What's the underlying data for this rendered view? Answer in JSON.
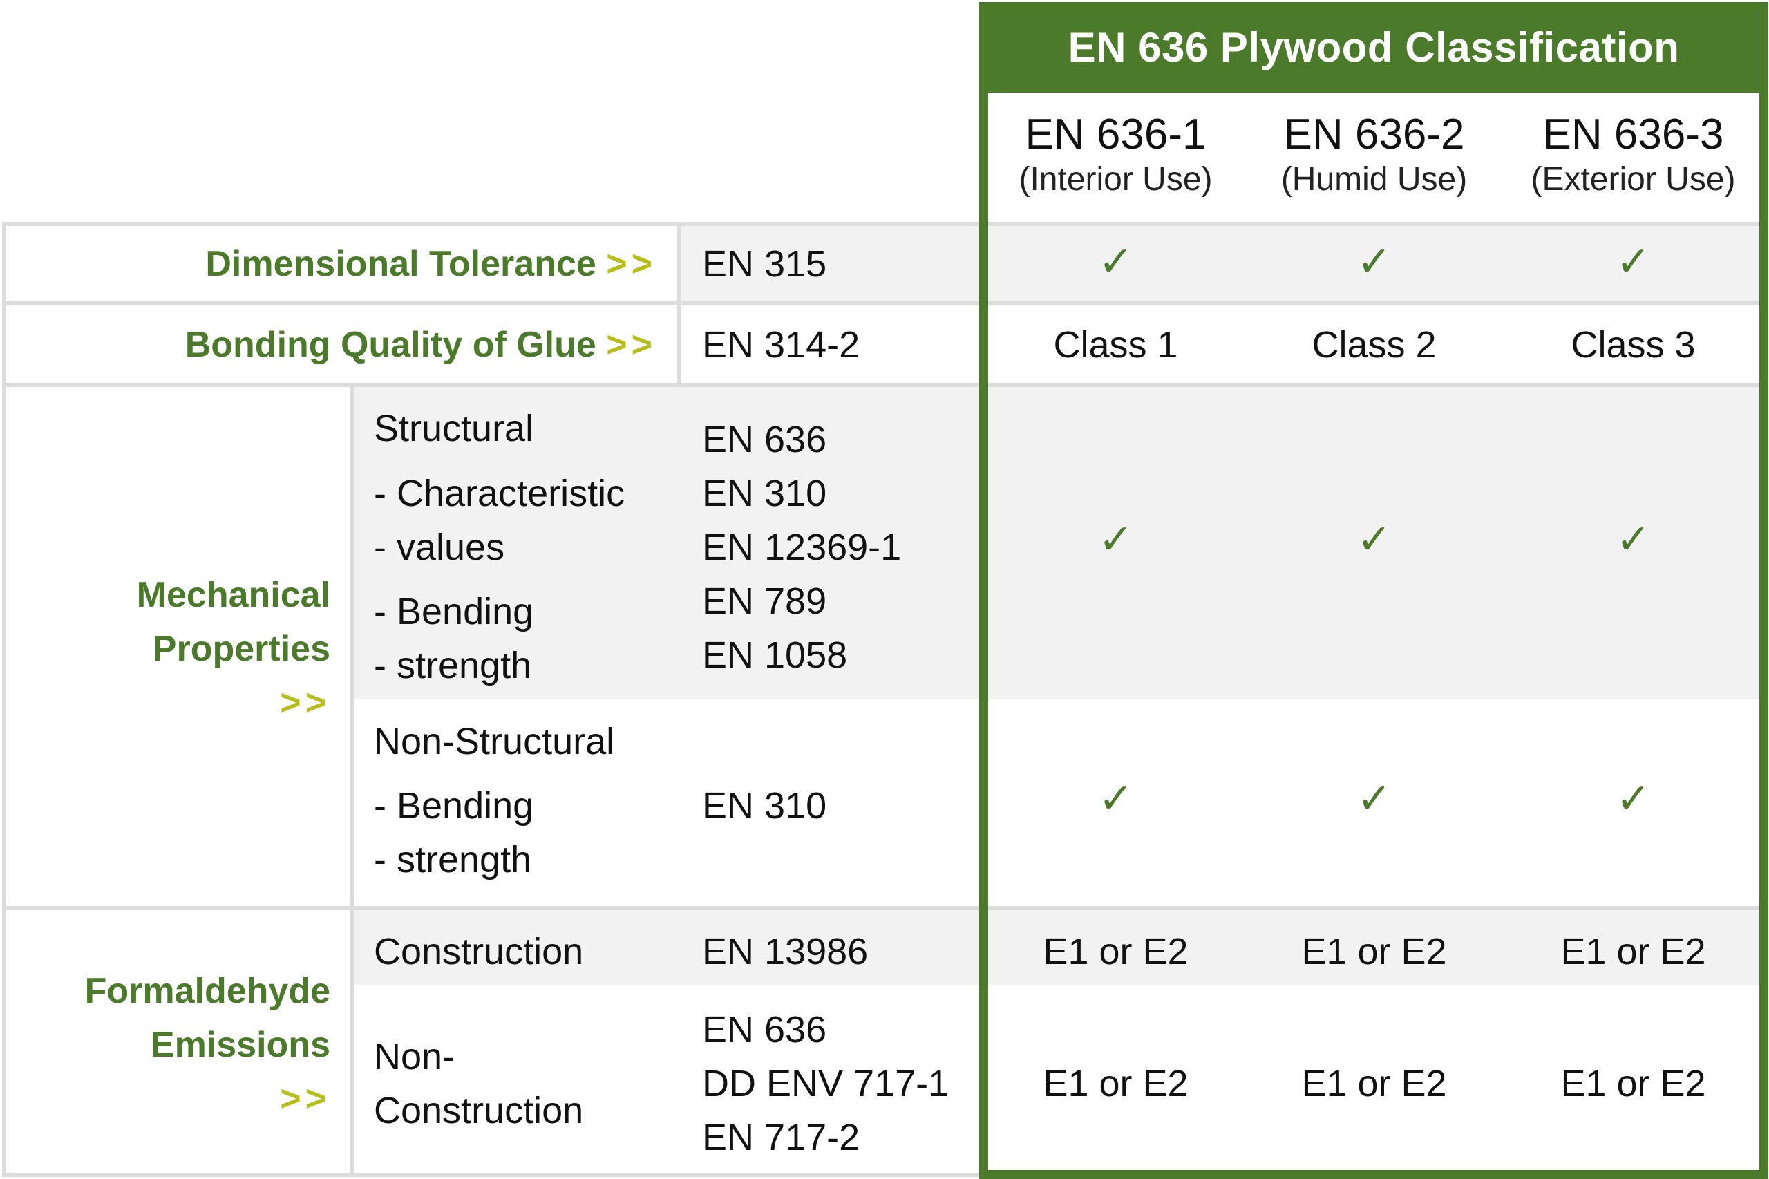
{
  "header": {
    "title": "EN 636 Plywood Classification",
    "columns": [
      {
        "code": "EN 636-1",
        "use": "(Interior Use)"
      },
      {
        "code": "EN 636-2",
        "use": "(Humid Use)"
      },
      {
        "code": "EN 636-3",
        "use": "(Exterior Use)"
      }
    ]
  },
  "chevron": ">>",
  "check_icon": "✓",
  "colors": {
    "brand_green": "#4a7a2a",
    "chevron_yellow_green": "#b5be1a",
    "row_gray": "#f2f2f2",
    "rule_gray": "#dcdcdc"
  },
  "rows": {
    "dimensional": {
      "label": "Dimensional Tolerance",
      "standard": "EN 315",
      "values": [
        "✓",
        "✓",
        "✓"
      ]
    },
    "bonding": {
      "label": "Bonding Quality of Glue",
      "standard": "EN 314-2",
      "values": [
        "Class 1",
        "Class 2",
        "Class 3"
      ]
    },
    "mechanical": {
      "label_line1": "Mechanical",
      "label_line2": "Properties",
      "structural": {
        "title": "Structural",
        "lines": [
          "- Characteristic",
          "- values",
          "- Bending",
          "- strength"
        ],
        "standards": [
          "EN 636",
          "EN 310",
          "EN 12369-1",
          "EN 789",
          "EN 1058"
        ],
        "values": [
          "✓",
          "✓",
          "✓"
        ]
      },
      "non_structural": {
        "title": "Non-Structural",
        "lines": [
          "- Bending",
          "- strength"
        ],
        "standards": [
          "EN 310"
        ],
        "values": [
          "✓",
          "✓",
          "✓"
        ]
      }
    },
    "formaldehyde": {
      "label_line1": "Formaldehyde",
      "label_line2": "Emissions",
      "construction": {
        "title": "Construction",
        "standards": [
          "EN 13986"
        ],
        "values": [
          "E1 or E2",
          "E1 or E2",
          "E1 or E2"
        ]
      },
      "non_construction": {
        "title_line1": "Non-",
        "title_line2": "Construction",
        "standards": [
          "EN 636",
          "DD ENV 717-1",
          "EN 717-2"
        ],
        "values": [
          "E1 or E2",
          "E1 or E2",
          "E1 or E2"
        ]
      }
    }
  }
}
